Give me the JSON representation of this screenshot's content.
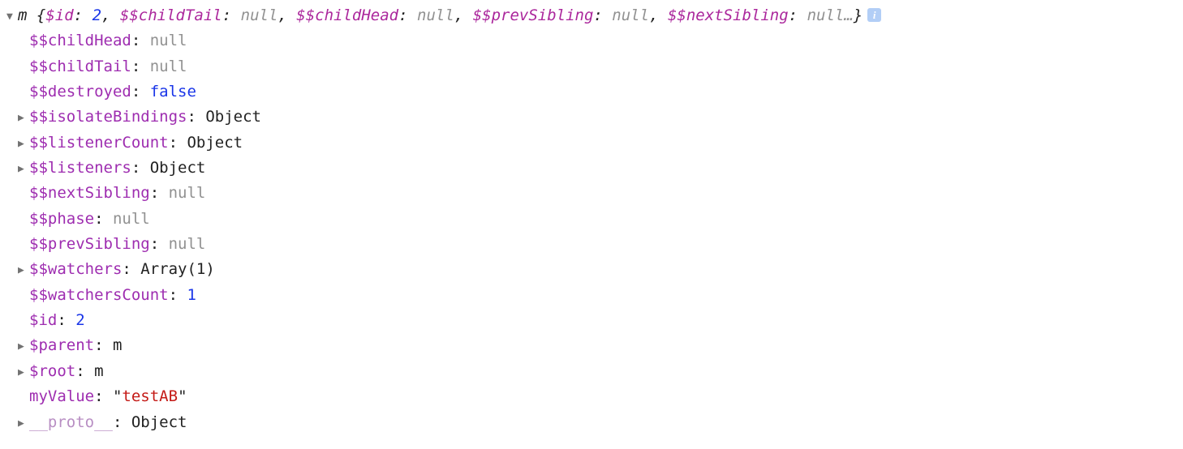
{
  "header": {
    "name": "m",
    "preview": [
      {
        "key": "$id",
        "type": "num",
        "value": "2"
      },
      {
        "key": "$$childTail",
        "type": "null",
        "value": "null"
      },
      {
        "key": "$$childHead",
        "type": "null",
        "value": "null"
      },
      {
        "key": "$$prevSibling",
        "type": "null",
        "value": "null"
      },
      {
        "key": "$$nextSibling",
        "type": "null",
        "value": "null"
      }
    ],
    "ellipsis": "…",
    "info_tooltip": "i"
  },
  "props": [
    {
      "key": "$$childHead",
      "expandable": false,
      "type": "null",
      "value": "null"
    },
    {
      "key": "$$childTail",
      "expandable": false,
      "type": "null",
      "value": "null"
    },
    {
      "key": "$$destroyed",
      "expandable": false,
      "type": "false",
      "value": "false"
    },
    {
      "key": "$$isolateBindings",
      "expandable": true,
      "type": "obj",
      "value": "Object"
    },
    {
      "key": "$$listenerCount",
      "expandable": true,
      "type": "obj",
      "value": "Object"
    },
    {
      "key": "$$listeners",
      "expandable": true,
      "type": "obj",
      "value": "Object"
    },
    {
      "key": "$$nextSibling",
      "expandable": false,
      "type": "null",
      "value": "null"
    },
    {
      "key": "$$phase",
      "expandable": false,
      "type": "null",
      "value": "null"
    },
    {
      "key": "$$prevSibling",
      "expandable": false,
      "type": "null",
      "value": "null"
    },
    {
      "key": "$$watchers",
      "expandable": true,
      "type": "obj",
      "value": "Array(1)"
    },
    {
      "key": "$$watchersCount",
      "expandable": false,
      "type": "num",
      "value": "1"
    },
    {
      "key": "$id",
      "expandable": false,
      "type": "num",
      "value": "2"
    },
    {
      "key": "$parent",
      "expandable": true,
      "type": "obj",
      "value": "m"
    },
    {
      "key": "$root",
      "expandable": true,
      "type": "obj",
      "value": "m"
    },
    {
      "key": "myValue",
      "expandable": false,
      "type": "str",
      "value": "testAB"
    },
    {
      "key": "__proto__",
      "expandable": true,
      "type": "obj",
      "value": "Object",
      "faded": true
    }
  ]
}
